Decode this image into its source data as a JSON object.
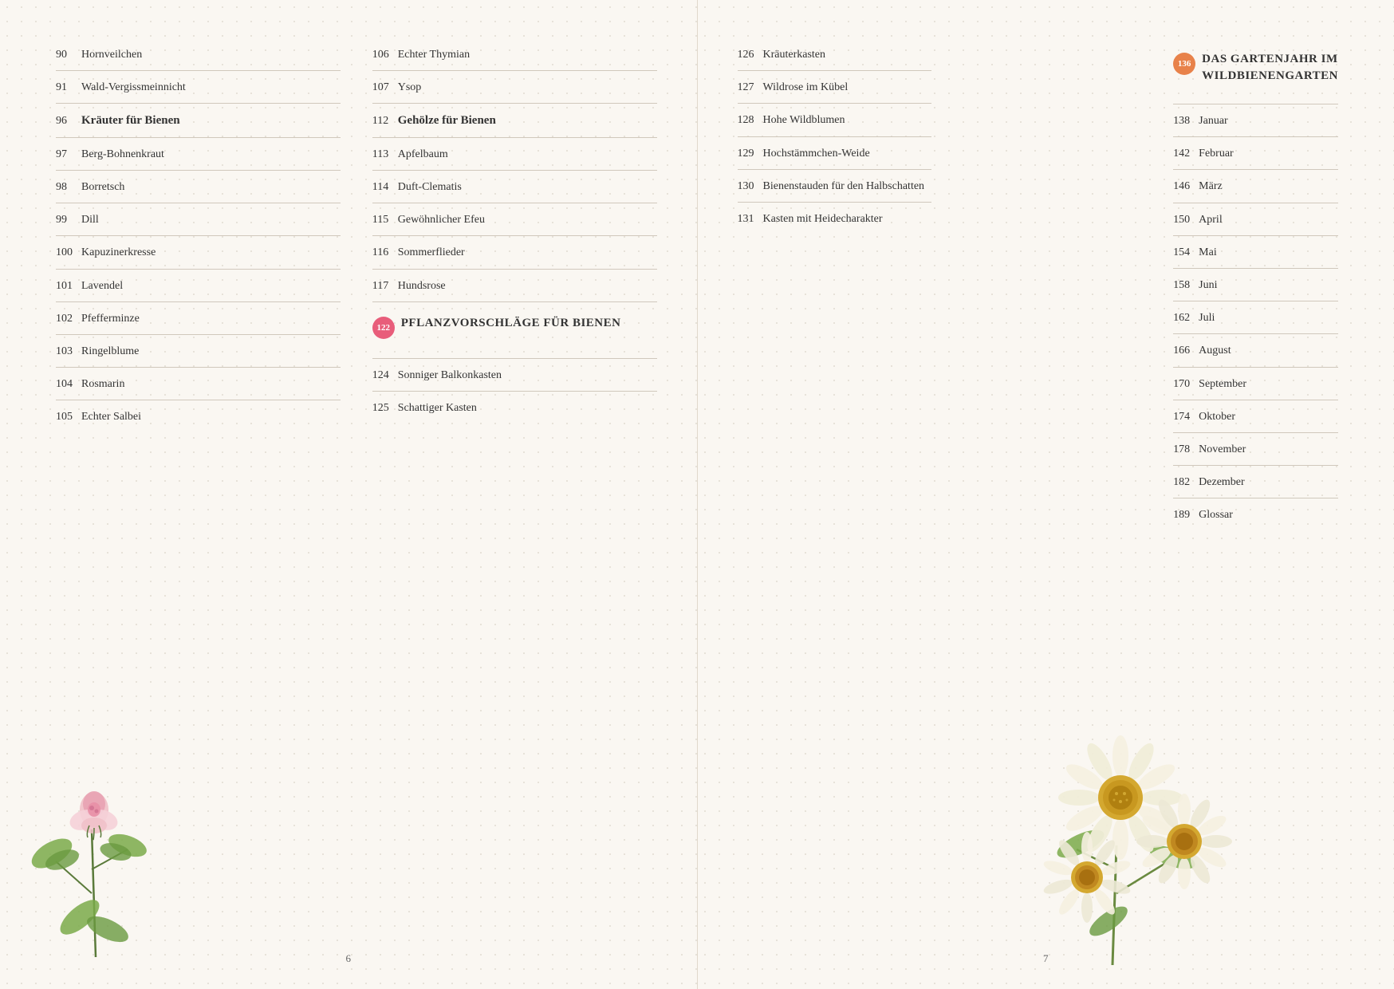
{
  "left_page": {
    "page_number": "6",
    "col1": [
      {
        "num": "90",
        "label": "Hornveilchen",
        "bold": false
      },
      {
        "num": "91",
        "label": "Wald-Vergissmeinnicht",
        "bold": false
      },
      {
        "num": "96",
        "label": "Kräuter für Bienen",
        "bold": true
      },
      {
        "num": "97",
        "label": "Berg-Bohnenkraut",
        "bold": false
      },
      {
        "num": "98",
        "label": "Borretsch",
        "bold": false
      },
      {
        "num": "99",
        "label": "Dill",
        "bold": false
      },
      {
        "num": "100",
        "label": "Kapuzinerkresse",
        "bold": false
      },
      {
        "num": "101",
        "label": "Lavendel",
        "bold": false
      },
      {
        "num": "102",
        "label": "Pfefferminze",
        "bold": false
      },
      {
        "num": "103",
        "label": "Ringelblume",
        "bold": false
      },
      {
        "num": "104",
        "label": "Rosmarin",
        "bold": false
      },
      {
        "num": "105",
        "label": "Echter Salbei",
        "bold": false
      }
    ],
    "col2": [
      {
        "num": "106",
        "label": "Echter Thymian",
        "bold": false
      },
      {
        "num": "107",
        "label": "Ysop",
        "bold": false
      },
      {
        "num": "112",
        "label": "Gehölze für Bienen",
        "bold": true
      },
      {
        "num": "113",
        "label": "Apfelbaum",
        "bold": false
      },
      {
        "num": "114",
        "label": "Duft-Clematis",
        "bold": false
      },
      {
        "num": "115",
        "label": "Gewöhnlicher Efeu",
        "bold": false
      },
      {
        "num": "116",
        "label": "Sommerflieder",
        "bold": false
      },
      {
        "num": "117",
        "label": "Hundsrose",
        "bold": false
      },
      {
        "num": "122",
        "label": "PFLANZVORSCHLÄGE FÜR BIENEN",
        "bold": true,
        "badge": true,
        "badge_color": "pink"
      },
      {
        "num": "124",
        "label": "Sonniger Balkonkasten",
        "bold": false
      },
      {
        "num": "125",
        "label": "Schattiger Kasten",
        "bold": false
      }
    ]
  },
  "right_page": {
    "page_number": "7",
    "col1": [
      {
        "num": "126",
        "label": "Kräuterkasten",
        "bold": false
      },
      {
        "num": "127",
        "label": "Wildrose im Kübel",
        "bold": false
      },
      {
        "num": "128",
        "label": "Hohe Wildblumen",
        "bold": false
      },
      {
        "num": "129",
        "label": "Hochstämmchen-Weide",
        "bold": false
      },
      {
        "num": "130",
        "label": "Bienenstauden für den Halbschatten",
        "bold": false
      },
      {
        "num": "131",
        "label": "Kasten mit Heidecharakter",
        "bold": false
      }
    ],
    "col2": [
      {
        "num": "136",
        "label": "DAS GARTENJAHR IM WILDBIENENGARTEN",
        "bold": true,
        "badge": true,
        "badge_color": "orange"
      },
      {
        "num": "138",
        "label": "Januar",
        "bold": false
      },
      {
        "num": "142",
        "label": "Februar",
        "bold": false
      },
      {
        "num": "146",
        "label": "März",
        "bold": false
      },
      {
        "num": "150",
        "label": "April",
        "bold": false
      },
      {
        "num": "154",
        "label": "Mai",
        "bold": false
      },
      {
        "num": "158",
        "label": "Juni",
        "bold": false
      },
      {
        "num": "162",
        "label": "Juli",
        "bold": false
      },
      {
        "num": "166",
        "label": "August",
        "bold": false
      },
      {
        "num": "170",
        "label": "September",
        "bold": false
      },
      {
        "num": "174",
        "label": "Oktober",
        "bold": false
      },
      {
        "num": "178",
        "label": "November",
        "bold": false
      },
      {
        "num": "182",
        "label": "Dezember",
        "bold": false
      },
      {
        "num": "189",
        "label": "Glossar",
        "bold": false
      }
    ]
  }
}
